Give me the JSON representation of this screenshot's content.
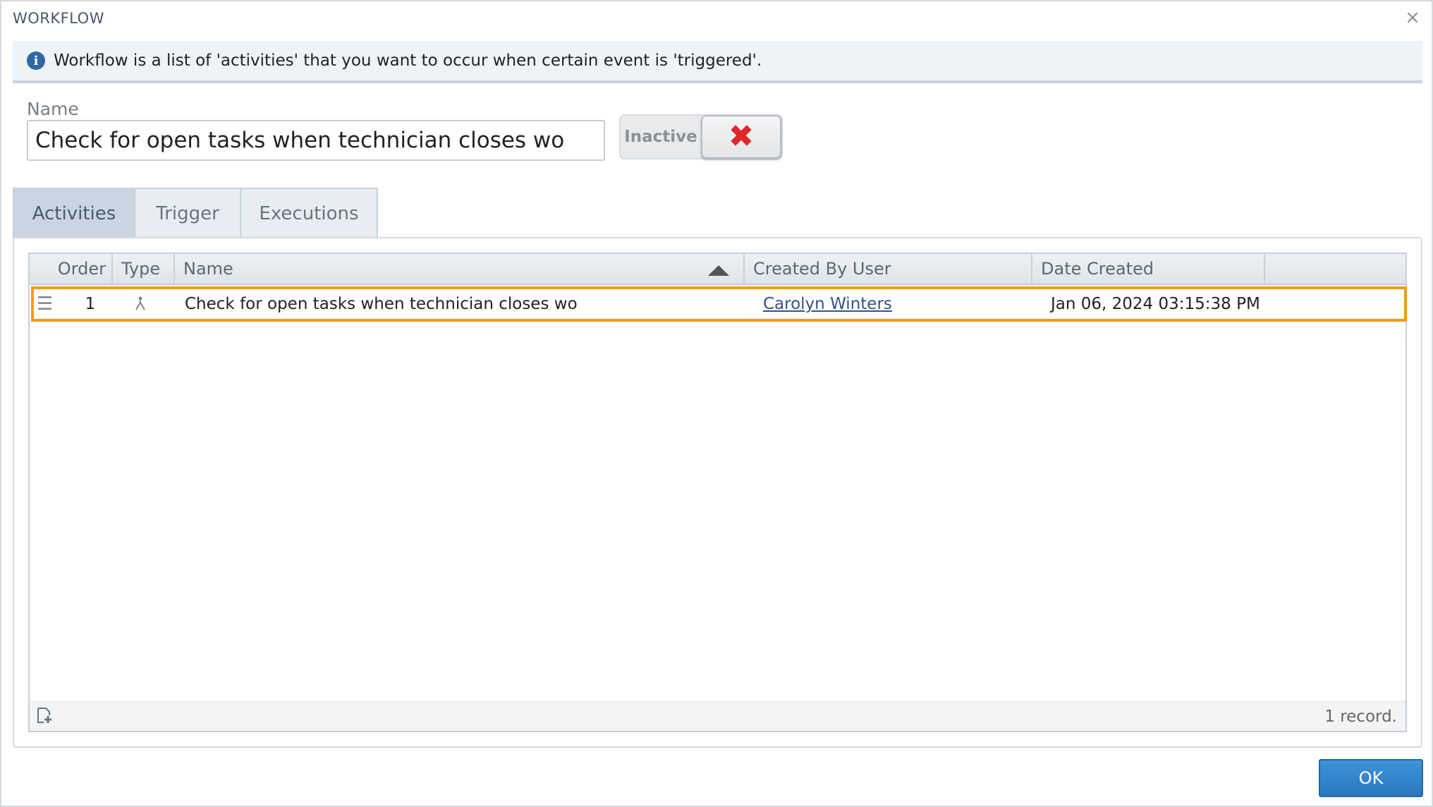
{
  "dialog": {
    "title": "WORKFLOW",
    "close_glyph": "×"
  },
  "info": {
    "icon": "info-icon",
    "text": "Workflow is a list of 'activities' that you want to occur when certain event is 'triggered'."
  },
  "form": {
    "name_label": "Name",
    "name_value": "Check for open tasks when technician closes wo",
    "status_label": "Inactive",
    "status_icon": "x-mark-icon",
    "status_color": "#e0262b"
  },
  "tabs": [
    {
      "label": "Activities",
      "active": true
    },
    {
      "label": "Trigger",
      "active": false
    },
    {
      "label": "Executions",
      "active": false
    }
  ],
  "grid": {
    "columns": [
      "Order",
      "Type",
      "Name",
      "Created By User",
      "Date Created"
    ],
    "sort_column": "Name",
    "rows": [
      {
        "order": "1",
        "type_icon": "branch-icon",
        "name": "Check for open tasks when technician closes wo",
        "created_by": "Carolyn Winters",
        "date_created": "Jan 06, 2024 03:15:38 PM"
      }
    ],
    "selected_row_color": "#f39a1c",
    "record_count": "1 record."
  },
  "actions": {
    "ok_label": "OK"
  }
}
